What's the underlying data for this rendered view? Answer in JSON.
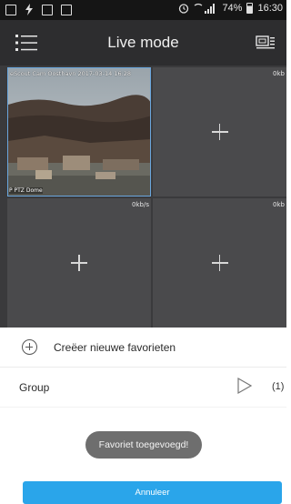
{
  "status_bar": {
    "battery": "74%",
    "time": "16:30",
    "icons": [
      "image-icon",
      "flash-icon",
      "download-icon",
      "briefcase-icon",
      "alarm-icon",
      "wifi-icon",
      "signal-icon",
      "battery-icon"
    ]
  },
  "header": {
    "title": "Live mode",
    "menu_icon": "list-menu-icon",
    "right_icon": "camera-list-icon"
  },
  "video_grid": {
    "tiles": [
      {
        "overlay_title": "eScout Cam Oosthavn 2017-03-14 16:28",
        "camera_label": "P PTZ Dome",
        "bitrate": ""
      },
      {
        "bitrate": "0kb"
      },
      {
        "bitrate": "0kb/s"
      },
      {
        "bitrate": "0kb"
      }
    ],
    "accent_color": "#6aa6dd"
  },
  "sheet": {
    "create_label": "Creëer nieuwe favorieten",
    "group_label": "Group",
    "group_count": "(1)"
  },
  "toast": "Favoriet toegevoegd!",
  "cancel_label": "Annuleer",
  "colors": {
    "header_bg": "#2d2d2f",
    "button_blue": "#2aa5ea"
  }
}
